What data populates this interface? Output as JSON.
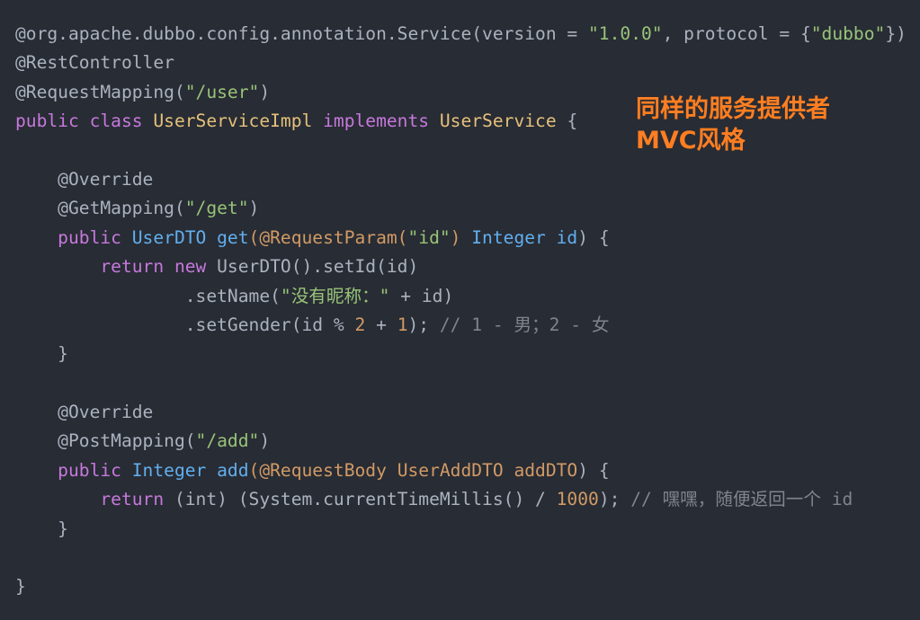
{
  "annotation": {
    "line1": "同样的服务提供者",
    "line2": "MVC风格"
  },
  "colors": {
    "background": "#282c34",
    "plain": "#abb2bf",
    "keyword": "#c678dd",
    "type": "#e5c07b",
    "function": "#61afef",
    "string": "#98c379",
    "number": "#d19a66",
    "comment": "#7f848e",
    "annotation_text": "#ff7e21"
  },
  "code_lines": [
    [
      {
        "text": "@org.apache.dubbo.config.annotation.Service(version = ",
        "kind": "a"
      },
      {
        "text": "\"1.0.0\"",
        "kind": "s"
      },
      {
        "text": ", protocol = {",
        "kind": "a"
      },
      {
        "text": "\"dubbo\"",
        "kind": "s"
      },
      {
        "text": "})",
        "kind": "a"
      }
    ],
    [
      {
        "text": "@RestController",
        "kind": "a"
      }
    ],
    [
      {
        "text": "@RequestMapping(",
        "kind": "a"
      },
      {
        "text": "\"/user\"",
        "kind": "s"
      },
      {
        "text": ")",
        "kind": "a"
      }
    ],
    [
      {
        "text": "public class ",
        "kind": "k"
      },
      {
        "text": "UserServiceImpl ",
        "kind": "t"
      },
      {
        "text": "implements ",
        "kind": "k"
      },
      {
        "text": "UserService ",
        "kind": "t"
      },
      {
        "text": "{",
        "kind": "plain"
      }
    ],
    [],
    [
      {
        "text": "    @Override",
        "kind": "a"
      }
    ],
    [
      {
        "text": "    @GetMapping(",
        "kind": "a"
      },
      {
        "text": "\"/get\"",
        "kind": "s"
      },
      {
        "text": ")",
        "kind": "a"
      }
    ],
    [
      {
        "text": "    public ",
        "kind": "k"
      },
      {
        "text": "UserDTO ",
        "kind": "f"
      },
      {
        "text": "get",
        "kind": "f"
      },
      {
        "text": "(@RequestParam(",
        "kind": "p"
      },
      {
        "text": "\"id\"",
        "kind": "s"
      },
      {
        "text": ") ",
        "kind": "p"
      },
      {
        "text": "Integer id",
        "kind": "f"
      },
      {
        "text": ") {",
        "kind": "plain"
      }
    ],
    [
      {
        "text": "        return new ",
        "kind": "k"
      },
      {
        "text": "UserDTO().setId(id)",
        "kind": "plain"
      }
    ],
    [
      {
        "text": "                .setName(",
        "kind": "plain"
      },
      {
        "text": "\"没有昵称：\"",
        "kind": "s"
      },
      {
        "text": " + id)",
        "kind": "plain"
      }
    ],
    [
      {
        "text": "                .setGender(id % ",
        "kind": "plain"
      },
      {
        "text": "2",
        "kind": "n"
      },
      {
        "text": " + ",
        "kind": "plain"
      },
      {
        "text": "1",
        "kind": "n"
      },
      {
        "text": "); ",
        "kind": "plain"
      },
      {
        "text": "// 1 - 男；2 - 女",
        "kind": "c"
      }
    ],
    [
      {
        "text": "    }",
        "kind": "plain"
      }
    ],
    [],
    [
      {
        "text": "    @Override",
        "kind": "a"
      }
    ],
    [
      {
        "text": "    @PostMapping(",
        "kind": "a"
      },
      {
        "text": "\"/add\"",
        "kind": "s"
      },
      {
        "text": ")",
        "kind": "a"
      }
    ],
    [
      {
        "text": "    public ",
        "kind": "k"
      },
      {
        "text": "Integer ",
        "kind": "f"
      },
      {
        "text": "add",
        "kind": "f"
      },
      {
        "text": "(@RequestBody ",
        "kind": "p"
      },
      {
        "text": "UserAddDTO addDTO",
        "kind": "p"
      },
      {
        "text": ") {",
        "kind": "plain"
      }
    ],
    [
      {
        "text": "        return ",
        "kind": "k"
      },
      {
        "text": "(int) (System.currentTimeMillis() / ",
        "kind": "plain"
      },
      {
        "text": "1000",
        "kind": "n"
      },
      {
        "text": "); ",
        "kind": "plain"
      },
      {
        "text": "// 嘿嘿，随便返回一个 id",
        "kind": "c"
      }
    ],
    [
      {
        "text": "    }",
        "kind": "plain"
      }
    ],
    [],
    [
      {
        "text": "}",
        "kind": "plain"
      }
    ]
  ]
}
